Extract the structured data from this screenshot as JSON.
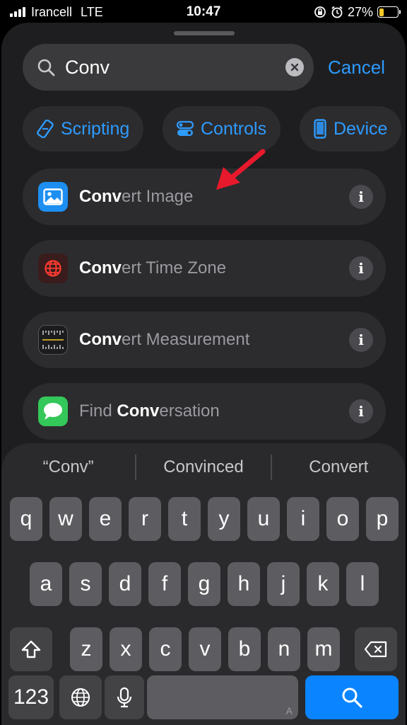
{
  "status_bar": {
    "carrier": "Irancell",
    "network": "LTE",
    "time": "10:47",
    "battery_percent": "27%",
    "battery_level": 0.27,
    "icons": [
      "signal-bars-icon",
      "lock-rotation-icon",
      "alarm-icon",
      "battery-charging-icon"
    ]
  },
  "search": {
    "query": "Conv",
    "cancel_label": "Cancel"
  },
  "categories": [
    {
      "label": "Scripting",
      "icon": "scripting-icon"
    },
    {
      "label": "Controls",
      "icon": "controls-icon"
    },
    {
      "label": "Device",
      "icon": "device-icon"
    }
  ],
  "results": [
    {
      "match": "Conv",
      "before": "",
      "after": "ert Image",
      "icon": "photo-icon",
      "icon_color": "#1d8ff2"
    },
    {
      "match": "Conv",
      "before": "",
      "after": "ert Time Zone",
      "icon": "globe-icon",
      "icon_color": "#3a1c1c"
    },
    {
      "match": "Conv",
      "before": "",
      "after": "ert Measurement",
      "icon": "ruler-icon",
      "icon_color": "#1c1c1e"
    },
    {
      "match": "Conv",
      "before": "Find ",
      "after": "ersation",
      "icon": "messages-icon",
      "icon_color": "#34c759"
    }
  ],
  "keyboard": {
    "suggestions": [
      "“Conv”",
      "Convinced",
      "Convert"
    ],
    "row1": [
      "q",
      "w",
      "e",
      "r",
      "t",
      "y",
      "u",
      "i",
      "o",
      "p"
    ],
    "row2": [
      "a",
      "s",
      "d",
      "f",
      "g",
      "h",
      "j",
      "k",
      "l"
    ],
    "row3": [
      "z",
      "x",
      "c",
      "v",
      "b",
      "n",
      "m"
    ],
    "numbers_label": "123",
    "space_mark": "A",
    "accent_color": "#0a84ff"
  }
}
